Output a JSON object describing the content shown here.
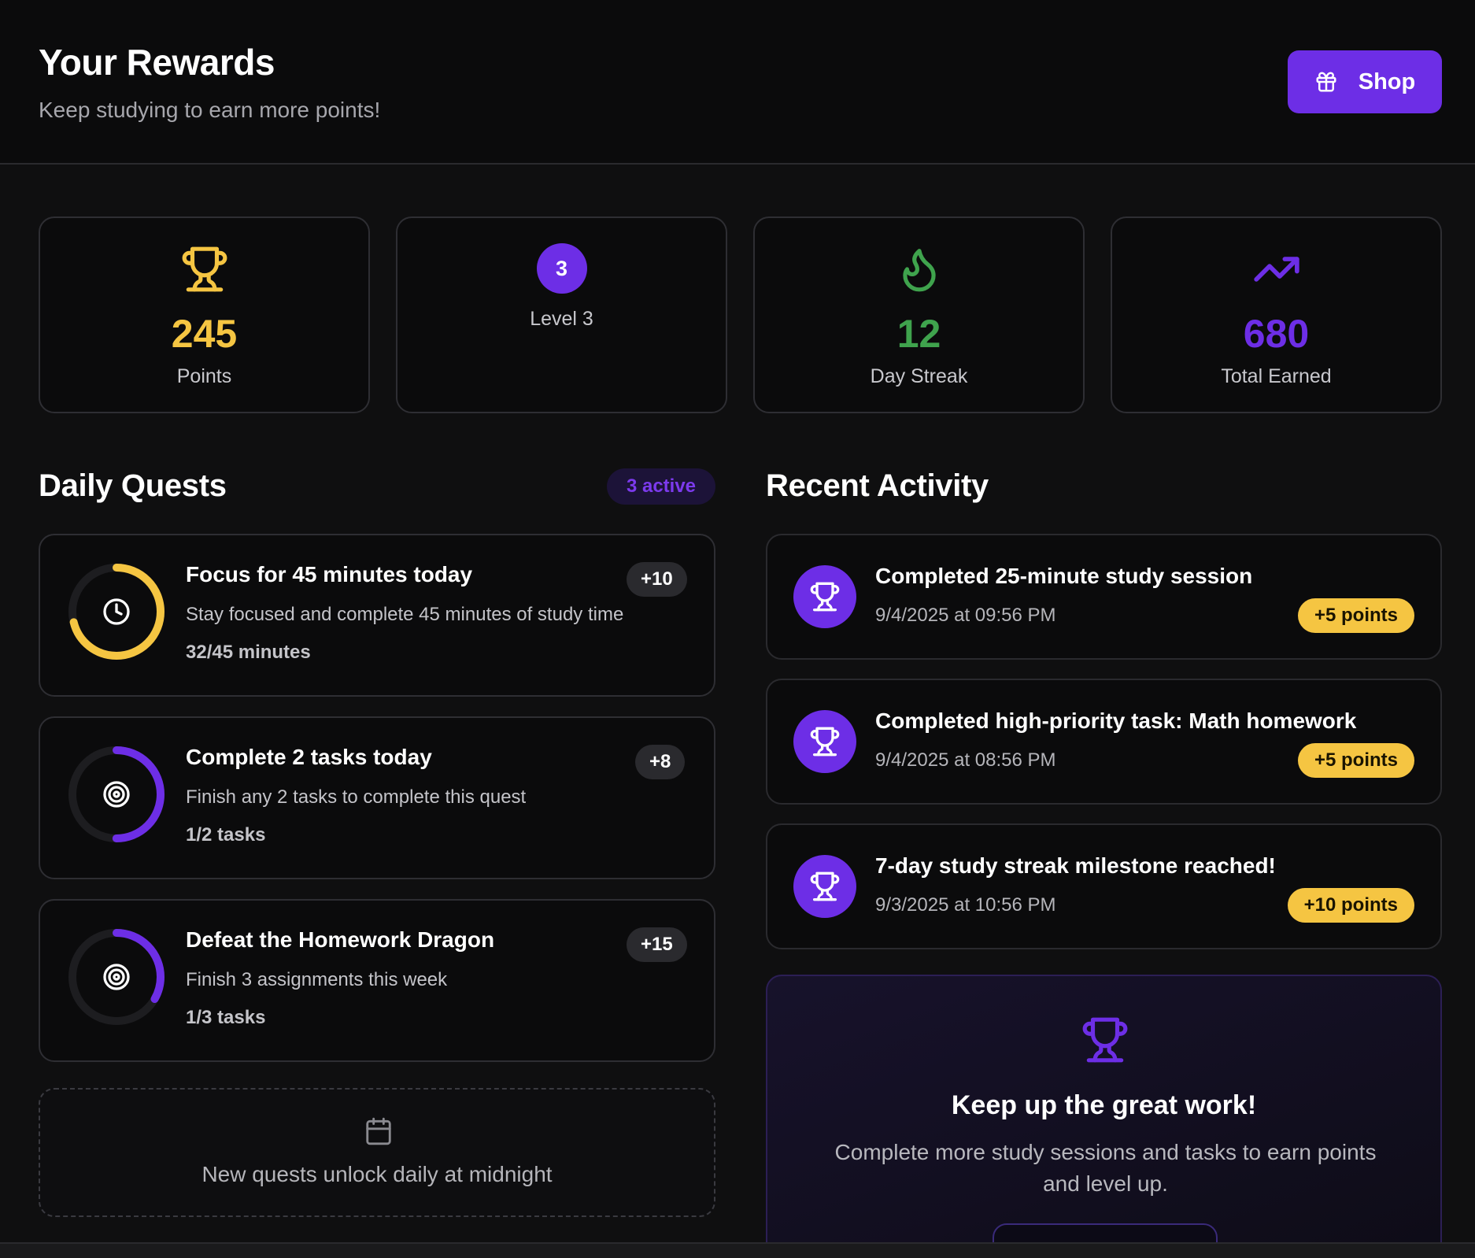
{
  "header": {
    "title": "Your Rewards",
    "subtitle": "Keep studying to earn more points!",
    "shop_label": "Shop"
  },
  "stats": [
    {
      "value": "245",
      "label": "Points",
      "icon": "trophy-icon",
      "color": "#f5c542"
    },
    {
      "value": "3",
      "label": "Level 3",
      "icon": "level-badge",
      "color": "#6d2ee6"
    },
    {
      "value": "12",
      "label": "Day Streak",
      "icon": "flame-icon",
      "color": "#3fa34d"
    },
    {
      "value": "680",
      "label": "Total Earned",
      "icon": "trending-up-icon",
      "color": "#6d2ee6"
    }
  ],
  "daily_quests": {
    "title": "Daily Quests",
    "active_badge": "3 active",
    "quests": [
      {
        "title": "Focus for 45 minutes today",
        "description": "Stay focused and complete 45 minutes of study time",
        "progress_text": "32/45 minutes",
        "points": "+10",
        "progress": 0.711,
        "ring_color": "#f5c542",
        "icon": "clock-icon"
      },
      {
        "title": "Complete 2 tasks today",
        "description": "Finish any 2 tasks to complete this quest",
        "progress_text": "1/2 tasks",
        "points": "+8",
        "progress": 0.5,
        "ring_color": "#6d2ee6",
        "icon": "target-icon"
      },
      {
        "title": "Defeat the Homework Dragon",
        "description": "Finish 3 assignments this week",
        "progress_text": "1/3 tasks",
        "points": "+15",
        "progress": 0.333,
        "ring_color": "#6d2ee6",
        "icon": "target-icon"
      }
    ],
    "note": "New quests unlock daily at midnight"
  },
  "recent_activity": {
    "title": "Recent Activity",
    "items": [
      {
        "title": "Completed 25-minute study session",
        "time": "9/4/2025 at 09:56 PM",
        "points": "+5 points"
      },
      {
        "title": "Completed high-priority task: Math homework",
        "time": "9/4/2025 at 08:56 PM",
        "points": "+5 points"
      },
      {
        "title": "7-day study streak milestone reached!",
        "time": "9/3/2025 at 10:56 PM",
        "points": "+10 points"
      }
    ]
  },
  "promo": {
    "title": "Keep up the great work!",
    "text": "Complete more study sessions and tasks to earn points and level up."
  },
  "colors": {
    "accent": "#6d2ee6",
    "gold": "#f5c542",
    "green": "#3fa34d"
  }
}
